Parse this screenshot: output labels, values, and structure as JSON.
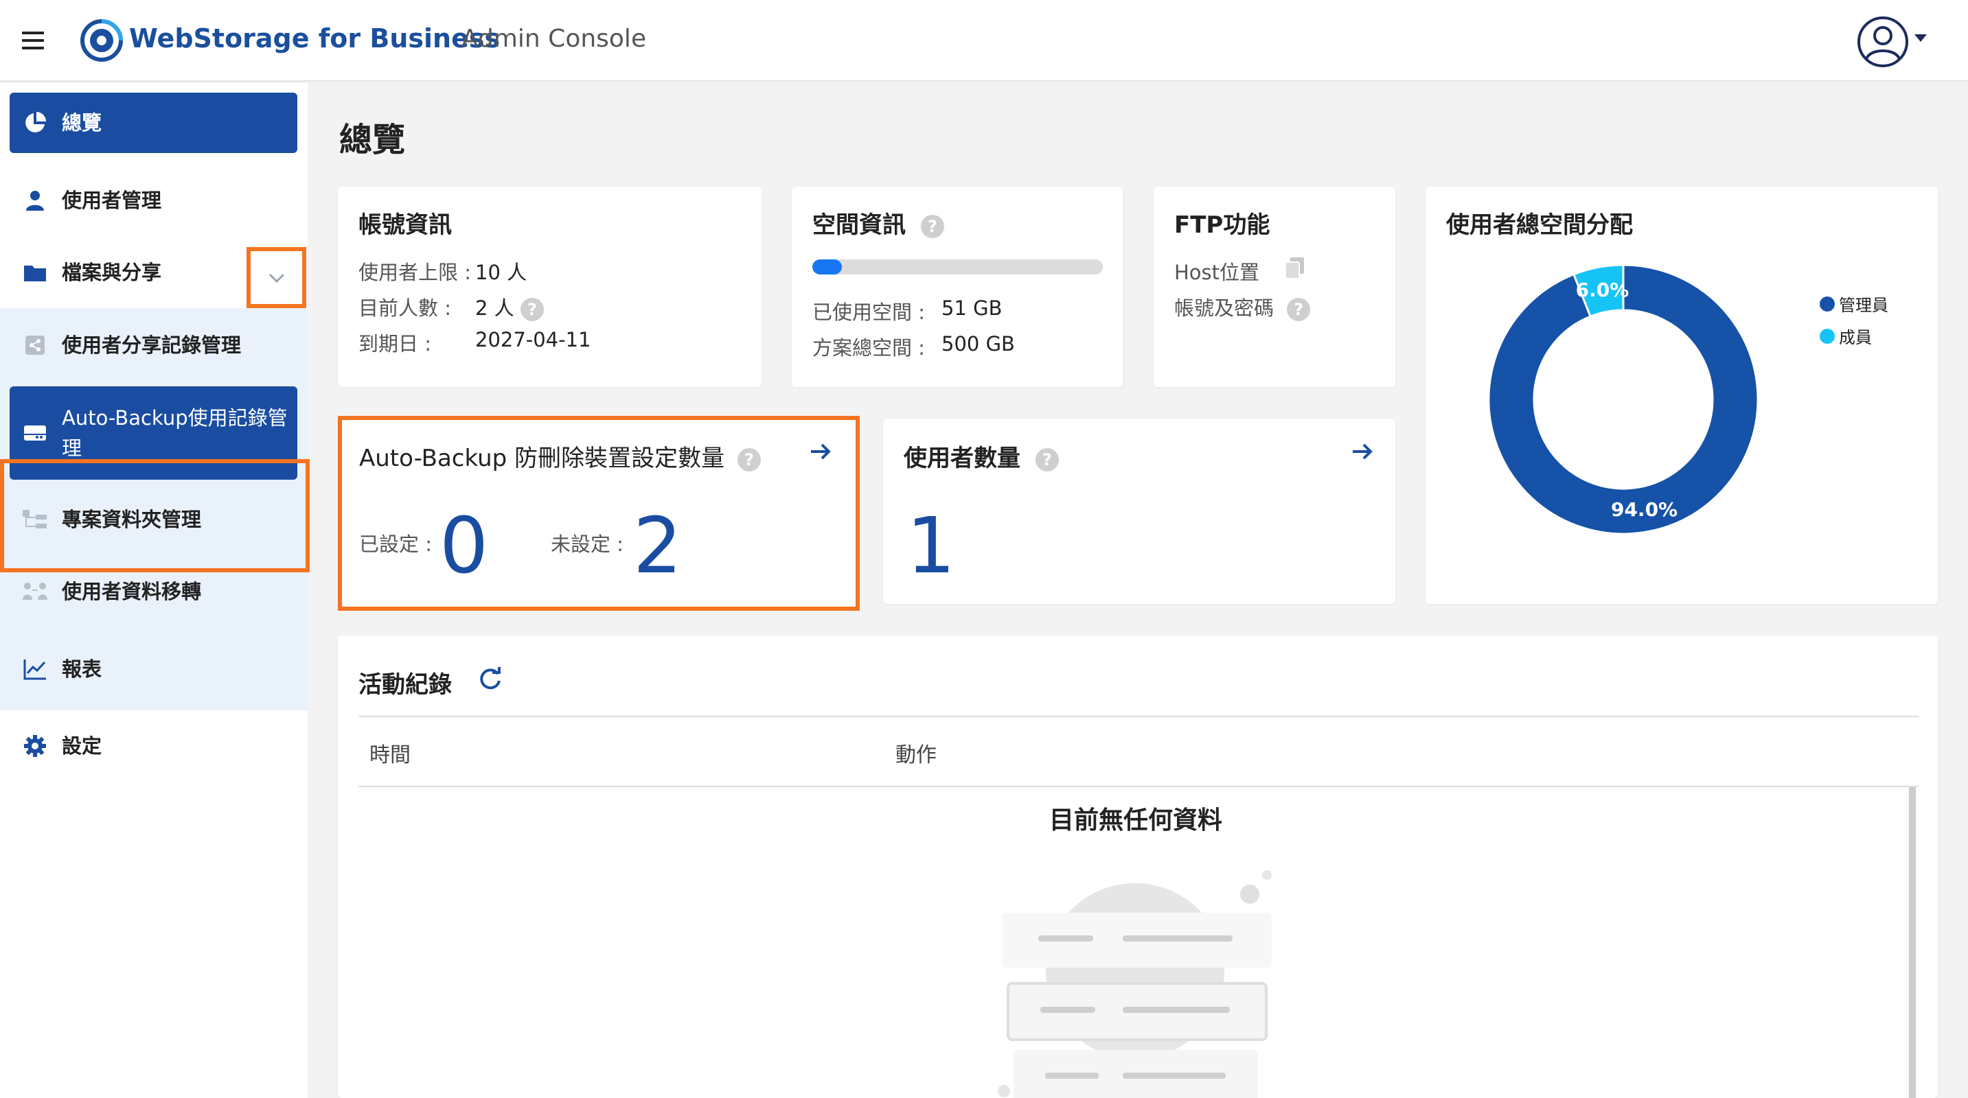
{
  "header": {
    "brand": "WebStorage for Business",
    "subtitle": "Admin Console",
    "menu_icon": "hamburger-icon",
    "user_icon": "user-avatar-icon"
  },
  "sidebar": {
    "items": [
      {
        "label": "總覽",
        "icon": "pie-chart-icon",
        "active": true
      },
      {
        "label": "使用者管理",
        "icon": "user-icon"
      },
      {
        "label": "檔案與分享",
        "icon": "folder-icon"
      },
      {
        "label": "使用者分享記錄管理",
        "icon": "share-icon"
      },
      {
        "label": "Auto-Backup使用記錄管理",
        "icon": "drive-icon",
        "active": true
      },
      {
        "label": "專案資料夾管理",
        "icon": "tree-icon"
      },
      {
        "label": "使用者資料移轉",
        "icon": "transfer-icon"
      },
      {
        "label": "報表",
        "icon": "line-chart-icon"
      },
      {
        "label": "設定",
        "icon": "gear-icon"
      }
    ]
  },
  "page": {
    "title": "總覽"
  },
  "account": {
    "title": "帳號資訊",
    "limit_label": "使用者上限 :",
    "limit_value": "10 人",
    "count_label": "目前人數 :",
    "count_value": "2 人",
    "expiry_label": "到期日 :",
    "expiry_value": "2027-04-11"
  },
  "space": {
    "title": "空間資訊",
    "used_label": "已使用空間 :",
    "used_value": "51 GB",
    "total_label": "方案總空間 :",
    "total_value": "500 GB",
    "used_fraction": 0.102,
    "bar_color": "#1976f2"
  },
  "ftp": {
    "title": "FTP功能",
    "host_label": "Host位置",
    "account_label": "帳號及密碼"
  },
  "storage_dist": {
    "title": "使用者總空間分配",
    "legend": [
      "管理員",
      "成員"
    ],
    "colors": [
      "#1552a8",
      "#15c4f5"
    ]
  },
  "chart_data": {
    "type": "pie",
    "title": "使用者總空間分配",
    "categories": [
      "管理員",
      "成員"
    ],
    "values": [
      94.0,
      6.0
    ],
    "labels": [
      "94.0%",
      "6.0%"
    ],
    "legend_position": "top-right"
  },
  "autobackup": {
    "title": "Auto-Backup 防刪除裝置設定數量",
    "set_label": "已設定 :",
    "set_value": "0",
    "unset_label": "未設定 :",
    "unset_value": "2"
  },
  "users": {
    "title": "使用者數量",
    "value": "1"
  },
  "activity": {
    "title": "活動紀錄",
    "columns": [
      "時間",
      "動作"
    ],
    "empty": "目前無任何資料"
  },
  "colors": {
    "primary": "#1a4da2",
    "highlight": "#f47421",
    "sub_nav_bg": "#e9f1fb"
  }
}
